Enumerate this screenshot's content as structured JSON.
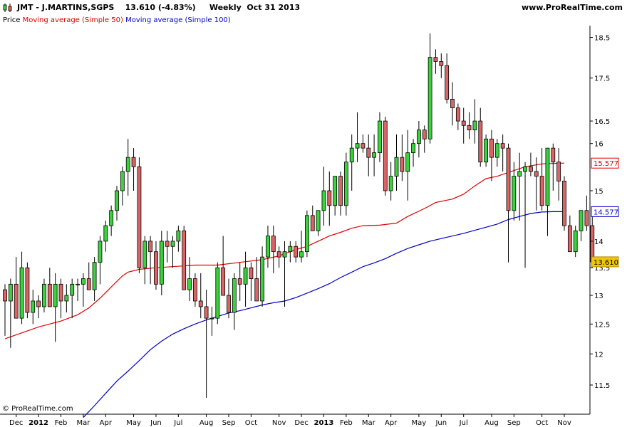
{
  "header": {
    "title": "JMT - J.MARTINS,SGPS    13.610 (-4.83%)     Weekly  Oct 31 2013",
    "site": "www.ProRealTime.com"
  },
  "legend": {
    "price": "Price",
    "ma50": "Moving average (Simple 50)",
    "ma100": "Moving average (Simple 100)"
  },
  "watermark": "© ProRealTime.com",
  "colors": {
    "up": "#3cd23c",
    "down": "#dc6464",
    "ma50": "#e00000",
    "ma100": "#0000c8",
    "last_price_badge": "#f0c800"
  },
  "chart_data": {
    "type": "candlestick",
    "y_scale": "log",
    "ylim": [
      11.05,
      18.8
    ],
    "y_ticks": [
      "11.5",
      "12",
      "12.5",
      "13",
      "13.5",
      "14",
      "15",
      "16",
      "16.5",
      "17.5",
      "18.5"
    ],
    "x_labels": [
      {
        "label": "Dec",
        "week": 2
      },
      {
        "label": "2012",
        "week": 6,
        "bold": true
      },
      {
        "label": "Feb",
        "week": 10
      },
      {
        "label": "Mar",
        "week": 14
      },
      {
        "label": "Apr",
        "week": 18
      },
      {
        "label": "May",
        "week": 23
      },
      {
        "label": "Jun",
        "week": 27
      },
      {
        "label": "Jul",
        "week": 31
      },
      {
        "label": "Aug",
        "week": 36
      },
      {
        "label": "Sep",
        "week": 40
      },
      {
        "label": "Oct",
        "week": 44
      },
      {
        "label": "Nov",
        "week": 49
      },
      {
        "label": "Dec",
        "week": 53
      },
      {
        "label": "2013",
        "week": 57,
        "bold": true
      },
      {
        "label": "Feb",
        "week": 61
      },
      {
        "label": "Mar",
        "week": 65
      },
      {
        "label": "Apr",
        "week": 69
      },
      {
        "label": "May",
        "week": 74
      },
      {
        "label": "Jun",
        "week": 78
      },
      {
        "label": "Jul",
        "week": 82
      },
      {
        "label": "Aug",
        "week": 87
      },
      {
        "label": "Sep",
        "week": 91
      },
      {
        "label": "Oct",
        "week": 96
      },
      {
        "label": "Nov",
        "week": 100
      }
    ],
    "last_values": {
      "ma50": "15.577",
      "ma100": "14.577",
      "price": "13.610"
    },
    "candles": [
      [
        13.1,
        13.2,
        12.3,
        12.9
      ],
      [
        12.9,
        13.3,
        12.1,
        13.2
      ],
      [
        13.2,
        13.7,
        12.8,
        12.6
      ],
      [
        12.6,
        13.8,
        12.5,
        13.5
      ],
      [
        13.5,
        13.6,
        12.6,
        12.7
      ],
      [
        12.7,
        13.1,
        12.5,
        12.9
      ],
      [
        12.9,
        13.0,
        12.6,
        12.8
      ],
      [
        12.8,
        13.3,
        12.7,
        13.2
      ],
      [
        13.2,
        13.5,
        12.9,
        12.8
      ],
      [
        12.8,
        13.4,
        12.2,
        13.2
      ],
      [
        13.2,
        13.3,
        12.6,
        12.9
      ],
      [
        12.9,
        13.2,
        12.7,
        13.0
      ],
      [
        13.0,
        13.3,
        12.6,
        13.2
      ],
      [
        13.2,
        13.3,
        12.9,
        13.2
      ],
      [
        13.2,
        13.4,
        12.8,
        13.3
      ],
      [
        13.3,
        13.6,
        13.2,
        13.1
      ],
      [
        13.1,
        13.7,
        12.9,
        13.6
      ],
      [
        13.6,
        14.1,
        13.2,
        14.0
      ],
      [
        14.0,
        14.4,
        13.8,
        14.3
      ],
      [
        14.3,
        14.7,
        14.1,
        14.6
      ],
      [
        14.6,
        15.1,
        14.4,
        15.0
      ],
      [
        15.0,
        15.5,
        14.7,
        15.4
      ],
      [
        15.4,
        16.1,
        14.9,
        15.7
      ],
      [
        15.7,
        15.9,
        15.0,
        15.5
      ],
      [
        15.5,
        15.7,
        13.4,
        13.5
      ],
      [
        13.5,
        14.1,
        13.2,
        14.0
      ],
      [
        14.0,
        14.1,
        13.2,
        13.8
      ],
      [
        13.8,
        14.0,
        13.1,
        13.2
      ],
      [
        13.2,
        14.2,
        13.0,
        14.0
      ],
      [
        14.0,
        14.2,
        13.6,
        13.9
      ],
      [
        13.9,
        14.1,
        13.5,
        14.0
      ],
      [
        14.0,
        14.3,
        13.8,
        14.2
      ],
      [
        14.2,
        14.3,
        13.3,
        13.1
      ],
      [
        13.1,
        13.7,
        12.9,
        13.3
      ],
      [
        13.3,
        13.4,
        12.8,
        12.9
      ],
      [
        12.9,
        13.4,
        12.6,
        12.8
      ],
      [
        12.8,
        13.1,
        11.3,
        12.6
      ],
      [
        12.6,
        12.8,
        12.3,
        12.6
      ],
      [
        12.6,
        13.6,
        12.5,
        13.5
      ],
      [
        13.5,
        14.1,
        13.1,
        13.0
      ],
      [
        13.0,
        13.3,
        12.6,
        12.7
      ],
      [
        12.7,
        13.4,
        12.4,
        13.3
      ],
      [
        13.3,
        13.6,
        12.9,
        13.2
      ],
      [
        13.2,
        13.8,
        12.8,
        13.5
      ],
      [
        13.5,
        13.6,
        12.9,
        13.3
      ],
      [
        13.3,
        13.7,
        12.9,
        12.9
      ],
      [
        12.9,
        13.9,
        12.8,
        13.7
      ],
      [
        13.7,
        14.3,
        13.5,
        14.1
      ],
      [
        14.1,
        14.3,
        13.4,
        13.8
      ],
      [
        13.8,
        13.9,
        13.5,
        13.7
      ],
      [
        13.7,
        14.0,
        12.8,
        13.8
      ],
      [
        13.8,
        14.0,
        13.6,
        13.9
      ],
      [
        13.9,
        14.0,
        13.6,
        13.7
      ],
      [
        13.7,
        14.2,
        13.6,
        13.8
      ],
      [
        13.8,
        14.6,
        13.7,
        14.5
      ],
      [
        14.5,
        14.7,
        14.2,
        14.2
      ],
      [
        14.2,
        14.6,
        14.1,
        14.6
      ],
      [
        14.6,
        15.5,
        14.3,
        15.0
      ],
      [
        15.0,
        15.4,
        14.3,
        14.7
      ],
      [
        14.7,
        15.3,
        14.5,
        15.3
      ],
      [
        15.3,
        15.4,
        14.5,
        14.7
      ],
      [
        14.7,
        15.8,
        14.5,
        15.6
      ],
      [
        15.6,
        16.2,
        15.0,
        15.9
      ],
      [
        15.9,
        16.7,
        15.6,
        16.0
      ],
      [
        16.0,
        16.2,
        15.8,
        15.9
      ],
      [
        15.9,
        16.2,
        15.3,
        15.7
      ],
      [
        15.7,
        16.2,
        15.3,
        15.8
      ],
      [
        15.8,
        16.7,
        15.6,
        16.5
      ],
      [
        16.5,
        16.6,
        14.9,
        15.0
      ],
      [
        15.0,
        15.6,
        14.8,
        15.3
      ],
      [
        15.3,
        16.2,
        15.0,
        15.7
      ],
      [
        15.7,
        16.2,
        15.2,
        15.4
      ],
      [
        15.4,
        16.3,
        14.8,
        15.8
      ],
      [
        15.8,
        16.1,
        15.5,
        16.0
      ],
      [
        16.0,
        16.5,
        15.7,
        16.3
      ],
      [
        16.3,
        16.4,
        15.8,
        16.1
      ],
      [
        16.1,
        18.6,
        16.0,
        18.0
      ],
      [
        18.0,
        18.2,
        17.6,
        17.9
      ],
      [
        17.9,
        18.1,
        17.5,
        17.8
      ],
      [
        17.8,
        18.1,
        16.9,
        17.0
      ],
      [
        17.0,
        17.4,
        16.4,
        16.8
      ],
      [
        16.8,
        16.9,
        16.3,
        16.5
      ],
      [
        16.5,
        16.8,
        16.0,
        16.4
      ],
      [
        16.4,
        16.7,
        16.1,
        16.3
      ],
      [
        16.3,
        17.0,
        16.0,
        16.5
      ],
      [
        16.5,
        16.8,
        15.5,
        15.6
      ],
      [
        15.6,
        16.2,
        15.5,
        16.1
      ],
      [
        16.1,
        16.3,
        15.2,
        15.7
      ],
      [
        15.7,
        16.1,
        15.5,
        16.0
      ],
      [
        16.0,
        16.2,
        15.4,
        15.9
      ],
      [
        15.9,
        16.0,
        13.6,
        14.6
      ],
      [
        14.6,
        15.6,
        14.4,
        15.3
      ],
      [
        15.3,
        15.8,
        14.4,
        15.4
      ],
      [
        15.4,
        15.6,
        13.5,
        15.5
      ],
      [
        15.5,
        15.8,
        15.3,
        15.4
      ],
      [
        15.4,
        15.7,
        14.6,
        15.3
      ],
      [
        15.3,
        15.9,
        14.6,
        14.7
      ],
      [
        14.7,
        15.8,
        14.1,
        15.9
      ],
      [
        15.9,
        16.0,
        15.0,
        15.6
      ],
      [
        15.6,
        15.9,
        14.8,
        15.2
      ],
      [
        15.2,
        15.3,
        14.2,
        14.3
      ],
      [
        14.3,
        14.5,
        13.8,
        13.8
      ],
      [
        13.8,
        14.3,
        13.7,
        14.2
      ],
      [
        14.2,
        14.6,
        14.0,
        14.6
      ],
      [
        14.6,
        14.9,
        14.2,
        14.3
      ],
      [
        14.3,
        14.5,
        13.5,
        13.61
      ]
    ],
    "ma50": [
      [
        0,
        12.25
      ],
      [
        6,
        12.45
      ],
      [
        10,
        12.55
      ],
      [
        13,
        12.66
      ],
      [
        15,
        12.78
      ],
      [
        17,
        12.95
      ],
      [
        19,
        13.15
      ],
      [
        21,
        13.35
      ],
      [
        22,
        13.42
      ],
      [
        24,
        13.47
      ],
      [
        27,
        13.5
      ],
      [
        30,
        13.52
      ],
      [
        34,
        13.55
      ],
      [
        38,
        13.55
      ],
      [
        42,
        13.6
      ],
      [
        46,
        13.65
      ],
      [
        49,
        13.72
      ],
      [
        52,
        13.84
      ],
      [
        54,
        13.9
      ],
      [
        56,
        14.0
      ],
      [
        58,
        14.1
      ],
      [
        60,
        14.17
      ],
      [
        62,
        14.25
      ],
      [
        64,
        14.3
      ],
      [
        67,
        14.31
      ],
      [
        70,
        14.35
      ],
      [
        72,
        14.48
      ],
      [
        75,
        14.64
      ],
      [
        77,
        14.76
      ],
      [
        80,
        14.83
      ],
      [
        82,
        14.93
      ],
      [
        84,
        15.1
      ],
      [
        86,
        15.25
      ],
      [
        88,
        15.3
      ],
      [
        90,
        15.38
      ],
      [
        93,
        15.5
      ],
      [
        96,
        15.56
      ],
      [
        98,
        15.57
      ],
      [
        100,
        15.577
      ]
    ],
    "ma100": [
      [
        14,
        11.0
      ],
      [
        16,
        11.18
      ],
      [
        18,
        11.37
      ],
      [
        20,
        11.56
      ],
      [
        22,
        11.72
      ],
      [
        24,
        11.89
      ],
      [
        26,
        12.07
      ],
      [
        28,
        12.21
      ],
      [
        30,
        12.33
      ],
      [
        32,
        12.42
      ],
      [
        34,
        12.5
      ],
      [
        36,
        12.57
      ],
      [
        38,
        12.63
      ],
      [
        40,
        12.69
      ],
      [
        42,
        12.73
      ],
      [
        44,
        12.78
      ],
      [
        46,
        12.83
      ],
      [
        48,
        12.87
      ],
      [
        50,
        12.9
      ],
      [
        52,
        12.96
      ],
      [
        54,
        13.04
      ],
      [
        56,
        13.12
      ],
      [
        58,
        13.21
      ],
      [
        60,
        13.32
      ],
      [
        62,
        13.42
      ],
      [
        64,
        13.52
      ],
      [
        66,
        13.59
      ],
      [
        68,
        13.67
      ],
      [
        70,
        13.77
      ],
      [
        72,
        13.86
      ],
      [
        74,
        13.93
      ],
      [
        76,
        14.0
      ],
      [
        78,
        14.05
      ],
      [
        80,
        14.1
      ],
      [
        82,
        14.15
      ],
      [
        84,
        14.21
      ],
      [
        86,
        14.27
      ],
      [
        88,
        14.33
      ],
      [
        90,
        14.42
      ],
      [
        92,
        14.48
      ],
      [
        94,
        14.54
      ],
      [
        96,
        14.57
      ],
      [
        98,
        14.577
      ],
      [
        100,
        14.577
      ]
    ]
  }
}
